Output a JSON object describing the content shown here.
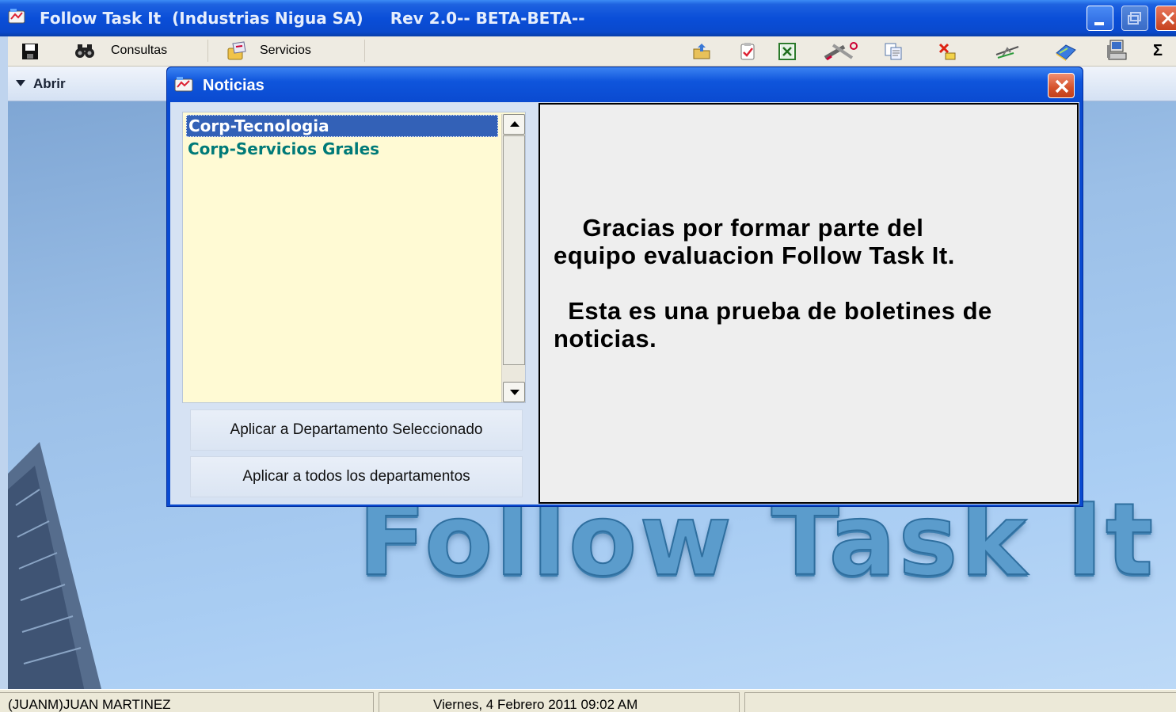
{
  "window": {
    "title": "Follow Task It  (Industrias Nigua SA)",
    "rev": "Rev 2.0-- BETA-BETA--"
  },
  "toolbar": {
    "consultas_label": "Consultas",
    "servicios_label": "Servicios",
    "sigma_label": "Σ",
    "icons": [
      "save-icon",
      "binoculars-icon",
      "services-icon",
      "folder-upload-icon",
      "checklist-icon",
      "excel-icon",
      "tools-icon",
      "copy-icon",
      "delete-icon",
      "plane-icon",
      "book-icon",
      "computer-icon",
      "sigma-icon"
    ]
  },
  "sidebar": {
    "abrir_label": "Abrir"
  },
  "background": {
    "logo_text": "Follow Task It"
  },
  "dialog": {
    "title": "Noticias",
    "departments": [
      {
        "label": "Corp-Tecnologia",
        "selected": true
      },
      {
        "label": "Corp-Servicios Grales",
        "selected": false
      }
    ],
    "btn_apply_selected": "Aplicar a Departamento Seleccionado",
    "btn_apply_all": "Aplicar a todos los departamentos",
    "news_line1": "    Gracias por formar parte del",
    "news_line2": "equipo evaluacion Follow Task It.",
    "news_line3": "  Esta es una prueba de boletines de",
    "news_line4": "noticias."
  },
  "statusbar": {
    "user": "(JUANM)JUAN MARTINEZ",
    "datetime": "Viernes, 4 Febrero  2011  09:02 AM",
    "extra": ""
  },
  "colors": {
    "title_blue": "#0a4ed8",
    "selection_blue": "#3361b7",
    "list_bg": "#fffad4",
    "teal_text": "#007a78",
    "close_red": "#d4512b"
  }
}
